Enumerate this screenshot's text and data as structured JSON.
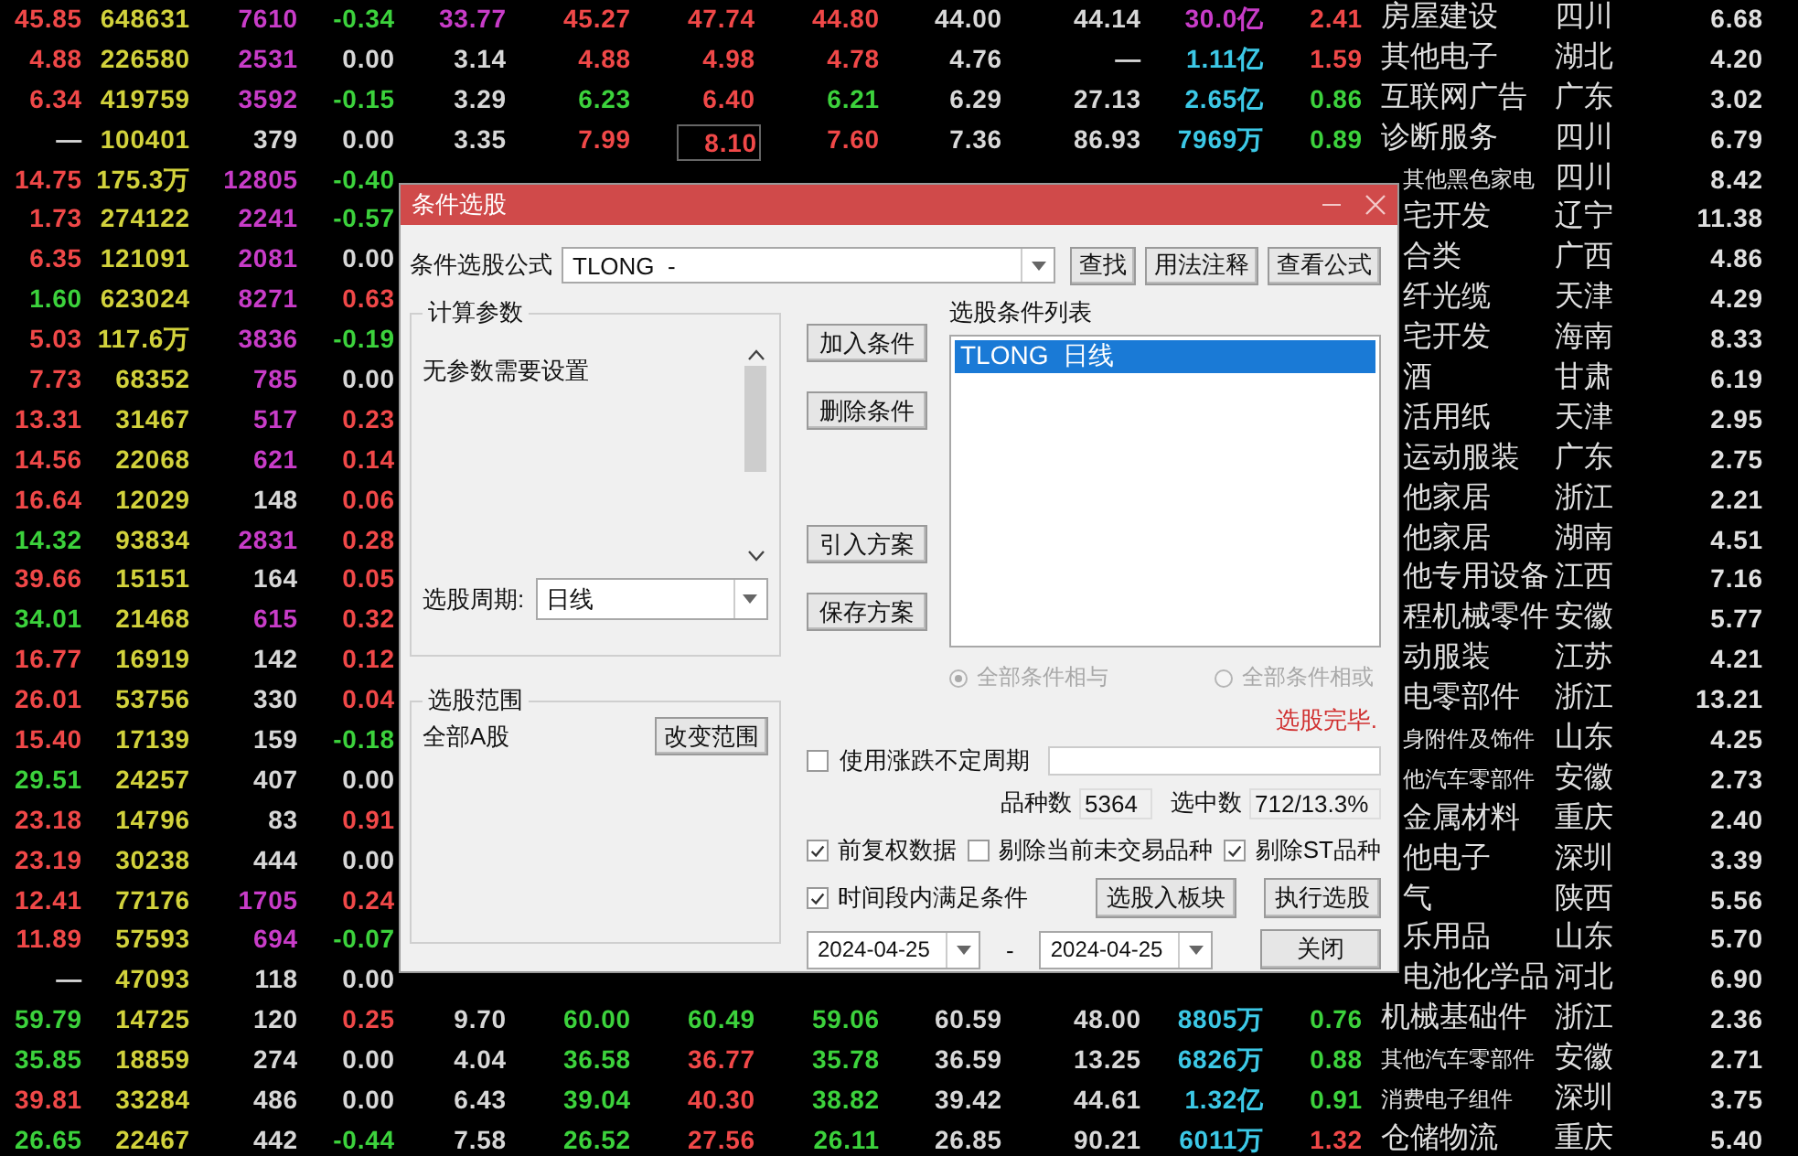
{
  "table": {
    "rows": [
      {
        "cells": [
          {
            "text": "45.85",
            "color": "#f04848"
          },
          {
            "text": "648631",
            "color": "#d2d23c"
          },
          {
            "text": "7610",
            "color": "#c83cc8"
          },
          {
            "text": "-0.34",
            "color": "#3cd23c"
          },
          {
            "text": "33.77",
            "color": "#c83cc8"
          },
          {
            "text": "45.27",
            "color": "#f04848"
          },
          {
            "text": "47.74",
            "color": "#f04848",
            "boxed": false
          },
          {
            "text": "44.80",
            "color": "#f04848"
          },
          {
            "text": "44.00",
            "color": "#d8d8d8"
          },
          {
            "text": "44.14",
            "color": "#d8d8d8"
          },
          {
            "text": "30.0亿",
            "color": "#c83cc8"
          },
          {
            "text": "2.41",
            "color": "#f04848"
          }
        ],
        "industry": "房屋建设",
        "region": "四川",
        "value": "6.68"
      },
      {
        "cells": [
          {
            "text": "4.88",
            "color": "#f04848"
          },
          {
            "text": "226580",
            "color": "#d2d23c"
          },
          {
            "text": "2531",
            "color": "#c83cc8"
          },
          {
            "text": "0.00",
            "color": "#d8d8d8"
          },
          {
            "text": "3.14",
            "color": "#d8d8d8"
          },
          {
            "text": "4.88",
            "color": "#f04848"
          },
          {
            "text": "4.98",
            "color": "#f04848",
            "boxed": false
          },
          {
            "text": "4.78",
            "color": "#f04848"
          },
          {
            "text": "4.76",
            "color": "#d8d8d8"
          },
          {
            "text": "—",
            "color": "#d8d8d8"
          },
          {
            "text": "1.11亿",
            "color": "#3cc8e6"
          },
          {
            "text": "1.59",
            "color": "#f04848"
          }
        ],
        "industry": "其他电子",
        "region": "湖北",
        "value": "4.20"
      },
      {
        "cells": [
          {
            "text": "6.34",
            "color": "#f04848"
          },
          {
            "text": "419759",
            "color": "#d2d23c"
          },
          {
            "text": "3592",
            "color": "#c83cc8"
          },
          {
            "text": "-0.15",
            "color": "#3cd23c"
          },
          {
            "text": "3.29",
            "color": "#d8d8d8"
          },
          {
            "text": "6.23",
            "color": "#3cd23c"
          },
          {
            "text": "6.40",
            "color": "#f04848",
            "boxed": false
          },
          {
            "text": "6.21",
            "color": "#3cd23c"
          },
          {
            "text": "6.29",
            "color": "#d8d8d8"
          },
          {
            "text": "27.13",
            "color": "#d8d8d8"
          },
          {
            "text": "2.65亿",
            "color": "#3cc8e6"
          },
          {
            "text": "0.86",
            "color": "#3cd23c"
          }
        ],
        "industry": "互联网广告",
        "region": "广东",
        "value": "3.02"
      },
      {
        "cells": [
          {
            "text": "—",
            "color": "#d8d8d8"
          },
          {
            "text": "100401",
            "color": "#d2d23c"
          },
          {
            "text": "379",
            "color": "#d8d8d8"
          },
          {
            "text": "0.00",
            "color": "#d8d8d8"
          },
          {
            "text": "3.35",
            "color": "#d8d8d8"
          },
          {
            "text": "7.99",
            "color": "#f04848"
          },
          {
            "text": "8.10",
            "color": "#f04848",
            "boxed": true
          },
          {
            "text": "7.60",
            "color": "#f04848"
          },
          {
            "text": "7.36",
            "color": "#d8d8d8"
          },
          {
            "text": "86.93",
            "color": "#d8d8d8"
          },
          {
            "text": "7969万",
            "color": "#3cc8e6"
          },
          {
            "text": "0.89",
            "color": "#3cd23c"
          }
        ],
        "industry": "诊断服务",
        "region": "四川",
        "value": "6.79"
      },
      {
        "cells": [
          {
            "text": "14.75",
            "color": "#f04848"
          },
          {
            "text": "175.3万",
            "color": "#d2d23c"
          },
          {
            "text": "12805",
            "color": "#c83cc8"
          },
          {
            "text": "-0.40",
            "color": "#3cd23c"
          }
        ],
        "industry": "其他黑色家电",
        "region": "四川",
        "value": "8.42"
      },
      {
        "cells": [
          {
            "text": "1.73",
            "color": "#f04848"
          },
          {
            "text": "274122",
            "color": "#d2d23c"
          },
          {
            "text": "2241",
            "color": "#c83cc8"
          },
          {
            "text": "-0.57",
            "color": "#3cd23c"
          }
        ],
        "industry": "宅开发",
        "region": "辽宁",
        "value": "11.38"
      },
      {
        "cells": [
          {
            "text": "6.35",
            "color": "#f04848"
          },
          {
            "text": "121091",
            "color": "#d2d23c"
          },
          {
            "text": "2081",
            "color": "#c83cc8"
          },
          {
            "text": "0.00",
            "color": "#d8d8d8"
          }
        ],
        "industry": "合类",
        "region": "广西",
        "value": "4.86"
      },
      {
        "cells": [
          {
            "text": "1.60",
            "color": "#3cd23c"
          },
          {
            "text": "623024",
            "color": "#d2d23c"
          },
          {
            "text": "8271",
            "color": "#c83cc8"
          },
          {
            "text": "0.63",
            "color": "#f04848"
          }
        ],
        "industry": "纤光缆",
        "region": "天津",
        "value": "4.29"
      },
      {
        "cells": [
          {
            "text": "5.03",
            "color": "#f04848"
          },
          {
            "text": "117.6万",
            "color": "#d2d23c"
          },
          {
            "text": "3836",
            "color": "#c83cc8"
          },
          {
            "text": "-0.19",
            "color": "#3cd23c"
          }
        ],
        "industry": "宅开发",
        "region": "海南",
        "value": "8.33"
      },
      {
        "cells": [
          {
            "text": "7.73",
            "color": "#f04848"
          },
          {
            "text": "68352",
            "color": "#d2d23c"
          },
          {
            "text": "785",
            "color": "#c83cc8"
          },
          {
            "text": "0.00",
            "color": "#d8d8d8"
          }
        ],
        "industry": "酒",
        "region": "甘肃",
        "value": "6.19"
      },
      {
        "cells": [
          {
            "text": "13.31",
            "color": "#f04848"
          },
          {
            "text": "31467",
            "color": "#d2d23c"
          },
          {
            "text": "517",
            "color": "#c83cc8"
          },
          {
            "text": "0.23",
            "color": "#f04848"
          }
        ],
        "industry": "活用纸",
        "region": "天津",
        "value": "2.95"
      },
      {
        "cells": [
          {
            "text": "14.56",
            "color": "#f04848"
          },
          {
            "text": "22068",
            "color": "#d2d23c"
          },
          {
            "text": "621",
            "color": "#c83cc8"
          },
          {
            "text": "0.14",
            "color": "#f04848"
          }
        ],
        "industry": "运动服装",
        "region": "广东",
        "value": "2.75"
      },
      {
        "cells": [
          {
            "text": "16.64",
            "color": "#f04848"
          },
          {
            "text": "12029",
            "color": "#d2d23c"
          },
          {
            "text": "148",
            "color": "#d8d8d8"
          },
          {
            "text": "0.06",
            "color": "#f04848"
          }
        ],
        "industry": "他家居",
        "region": "浙江",
        "value": "2.21"
      },
      {
        "cells": [
          {
            "text": "14.32",
            "color": "#3cd23c"
          },
          {
            "text": "93834",
            "color": "#d2d23c"
          },
          {
            "text": "2831",
            "color": "#c83cc8"
          },
          {
            "text": "0.28",
            "color": "#f04848"
          }
        ],
        "industry": "他家居",
        "region": "湖南",
        "value": "4.51"
      },
      {
        "cells": [
          {
            "text": "39.66",
            "color": "#f04848"
          },
          {
            "text": "15151",
            "color": "#d2d23c"
          },
          {
            "text": "164",
            "color": "#d8d8d8"
          },
          {
            "text": "0.05",
            "color": "#f04848"
          }
        ],
        "industry": "他专用设备",
        "region": "江西",
        "value": "7.16"
      },
      {
        "cells": [
          {
            "text": "34.01",
            "color": "#3cd23c"
          },
          {
            "text": "21468",
            "color": "#d2d23c"
          },
          {
            "text": "615",
            "color": "#c83cc8"
          },
          {
            "text": "0.32",
            "color": "#f04848"
          }
        ],
        "industry": "程机械零件",
        "region": "安徽",
        "value": "5.77"
      },
      {
        "cells": [
          {
            "text": "16.77",
            "color": "#f04848"
          },
          {
            "text": "16919",
            "color": "#d2d23c"
          },
          {
            "text": "142",
            "color": "#d8d8d8"
          },
          {
            "text": "0.12",
            "color": "#f04848"
          }
        ],
        "industry": "动服装",
        "region": "江苏",
        "value": "4.21"
      },
      {
        "cells": [
          {
            "text": "26.01",
            "color": "#f04848"
          },
          {
            "text": "53756",
            "color": "#d2d23c"
          },
          {
            "text": "330",
            "color": "#d8d8d8"
          },
          {
            "text": "0.04",
            "color": "#f04848"
          }
        ],
        "industry": "电零部件",
        "region": "浙江",
        "value": "13.21"
      },
      {
        "cells": [
          {
            "text": "15.40",
            "color": "#f04848"
          },
          {
            "text": "17139",
            "color": "#d2d23c"
          },
          {
            "text": "159",
            "color": "#d8d8d8"
          },
          {
            "text": "-0.18",
            "color": "#3cd23c"
          }
        ],
        "industry": "身附件及饰件",
        "region": "山东",
        "value": "4.25"
      },
      {
        "cells": [
          {
            "text": "29.51",
            "color": "#3cd23c"
          },
          {
            "text": "24257",
            "color": "#d2d23c"
          },
          {
            "text": "407",
            "color": "#d8d8d8"
          },
          {
            "text": "0.00",
            "color": "#d8d8d8"
          }
        ],
        "industry": "他汽车零部件",
        "region": "安徽",
        "value": "2.73"
      },
      {
        "cells": [
          {
            "text": "23.18",
            "color": "#f04848"
          },
          {
            "text": "14796",
            "color": "#d2d23c"
          },
          {
            "text": "83",
            "color": "#d8d8d8"
          },
          {
            "text": "0.91",
            "color": "#f04848"
          }
        ],
        "industry": "金属材料",
        "region": "重庆",
        "value": "2.40"
      },
      {
        "cells": [
          {
            "text": "23.19",
            "color": "#f04848"
          },
          {
            "text": "30238",
            "color": "#d2d23c"
          },
          {
            "text": "444",
            "color": "#d8d8d8"
          },
          {
            "text": "0.00",
            "color": "#d8d8d8"
          }
        ],
        "industry": "他电子",
        "region": "深圳",
        "value": "3.39"
      },
      {
        "cells": [
          {
            "text": "12.41",
            "color": "#f04848"
          },
          {
            "text": "77176",
            "color": "#d2d23c"
          },
          {
            "text": "1705",
            "color": "#c83cc8"
          },
          {
            "text": "0.24",
            "color": "#f04848"
          }
        ],
        "industry": "气",
        "region": "陕西",
        "value": "5.56"
      },
      {
        "cells": [
          {
            "text": "11.89",
            "color": "#f04848"
          },
          {
            "text": "57593",
            "color": "#d2d23c"
          },
          {
            "text": "694",
            "color": "#c83cc8"
          },
          {
            "text": "-0.07",
            "color": "#3cd23c"
          }
        ],
        "industry": "乐用品",
        "region": "山东",
        "value": "5.70"
      },
      {
        "cells": [
          {
            "text": "—",
            "color": "#d8d8d8"
          },
          {
            "text": "47093",
            "color": "#d2d23c"
          },
          {
            "text": "118",
            "color": "#d8d8d8"
          },
          {
            "text": "0.00",
            "color": "#d8d8d8"
          }
        ],
        "industry": "电池化学品",
        "region": "河北",
        "value": "6.90"
      },
      {
        "cells": [
          {
            "text": "59.79",
            "color": "#3cd23c"
          },
          {
            "text": "14725",
            "color": "#d2d23c"
          },
          {
            "text": "120",
            "color": "#d8d8d8"
          },
          {
            "text": "0.25",
            "color": "#f04848"
          },
          {
            "text": "9.70",
            "color": "#d8d8d8"
          },
          {
            "text": "60.00",
            "color": "#3cd23c"
          },
          {
            "text": "60.49",
            "color": "#3cd23c",
            "boxed": false
          },
          {
            "text": "59.06",
            "color": "#3cd23c"
          },
          {
            "text": "60.59",
            "color": "#d8d8d8"
          },
          {
            "text": "48.00",
            "color": "#d8d8d8"
          },
          {
            "text": "8805万",
            "color": "#3cc8e6"
          },
          {
            "text": "0.76",
            "color": "#3cd23c"
          }
        ],
        "industry": "机械基础件",
        "region": "浙江",
        "value": "2.36"
      },
      {
        "cells": [
          {
            "text": "35.85",
            "color": "#3cd23c"
          },
          {
            "text": "18859",
            "color": "#d2d23c"
          },
          {
            "text": "274",
            "color": "#d8d8d8"
          },
          {
            "text": "0.00",
            "color": "#d8d8d8"
          },
          {
            "text": "4.04",
            "color": "#d8d8d8"
          },
          {
            "text": "36.58",
            "color": "#3cd23c"
          },
          {
            "text": "36.77",
            "color": "#f04848",
            "boxed": false
          },
          {
            "text": "35.78",
            "color": "#3cd23c"
          },
          {
            "text": "36.59",
            "color": "#d8d8d8"
          },
          {
            "text": "13.25",
            "color": "#d8d8d8"
          },
          {
            "text": "6826万",
            "color": "#3cc8e6"
          },
          {
            "text": "0.88",
            "color": "#3cd23c"
          }
        ],
        "industry": "其他汽车零部件",
        "region": "安徽",
        "value": "2.71"
      },
      {
        "cells": [
          {
            "text": "39.81",
            "color": "#f04848"
          },
          {
            "text": "33284",
            "color": "#d2d23c"
          },
          {
            "text": "486",
            "color": "#d8d8d8"
          },
          {
            "text": "0.00",
            "color": "#d8d8d8"
          },
          {
            "text": "6.43",
            "color": "#d8d8d8"
          },
          {
            "text": "39.04",
            "color": "#3cd23c"
          },
          {
            "text": "40.30",
            "color": "#f04848",
            "boxed": false
          },
          {
            "text": "38.82",
            "color": "#3cd23c"
          },
          {
            "text": "39.42",
            "color": "#d8d8d8"
          },
          {
            "text": "44.61",
            "color": "#d8d8d8"
          },
          {
            "text": "1.32亿",
            "color": "#3cc8e6"
          },
          {
            "text": "0.91",
            "color": "#3cd23c"
          }
        ],
        "industry": "消费电子组件",
        "region": "深圳",
        "value": "3.75"
      },
      {
        "cells": [
          {
            "text": "26.65",
            "color": "#3cd23c"
          },
          {
            "text": "22467",
            "color": "#d2d23c"
          },
          {
            "text": "442",
            "color": "#d8d8d8"
          },
          {
            "text": "-0.44",
            "color": "#3cd23c"
          },
          {
            "text": "7.58",
            "color": "#d8d8d8"
          },
          {
            "text": "26.52",
            "color": "#3cd23c"
          },
          {
            "text": "27.56",
            "color": "#f04848",
            "boxed": false
          },
          {
            "text": "26.11",
            "color": "#3cd23c"
          },
          {
            "text": "26.85",
            "color": "#d8d8d8"
          },
          {
            "text": "90.21",
            "color": "#d8d8d8"
          },
          {
            "text": "6011万",
            "color": "#3cc8e6"
          },
          {
            "text": "1.32",
            "color": "#f04848"
          }
        ],
        "industry": "仓储物流",
        "region": "重庆",
        "value": "5.40"
      }
    ]
  },
  "dialog": {
    "title": "条件选股",
    "formula": {
      "label": "条件选股公式",
      "value": "TLONG  -"
    },
    "formula_buttons": [
      "查找",
      "用法注释",
      "查看公式"
    ],
    "params": {
      "title": "计算参数",
      "message": "无参数需要设置",
      "period_label": "选股周期:",
      "period_value": "日线"
    },
    "scope": {
      "title": "选股范围",
      "value": "全部A股",
      "button": "改变范围"
    },
    "side_buttons": [
      "加入条件",
      "删除条件",
      "引入方案",
      "保存方案"
    ],
    "condition_list": {
      "label": "选股条件列表",
      "items": [
        {
          "text": "TLONG  日线",
          "selected": true
        }
      ]
    },
    "logic_options": [
      {
        "label": "全部条件相与",
        "selected": true,
        "disabled": true
      },
      {
        "label": "全部条件相或",
        "selected": false,
        "disabled": true
      }
    ],
    "status": "选股完毕.",
    "variable_period": {
      "label": "使用涨跌不定周期",
      "checked": false
    },
    "counts": [
      {
        "label": "品种数",
        "value": "5364"
      },
      {
        "label": "选中数",
        "value": "712/13.3%"
      }
    ],
    "options": [
      {
        "label": "前复权数据",
        "checked": true
      },
      {
        "label": "剔除当前未交易品种",
        "checked": false
      },
      {
        "label": "剔除ST品种",
        "checked": true
      }
    ],
    "time_option": {
      "label": "时间段内满足条件",
      "checked": true
    },
    "action_buttons": [
      "选股入板块",
      "执行选股"
    ],
    "date_from": "2024-04-25",
    "date_separator": "-",
    "date_to": "2024-04-25",
    "close_button": "关闭"
  }
}
